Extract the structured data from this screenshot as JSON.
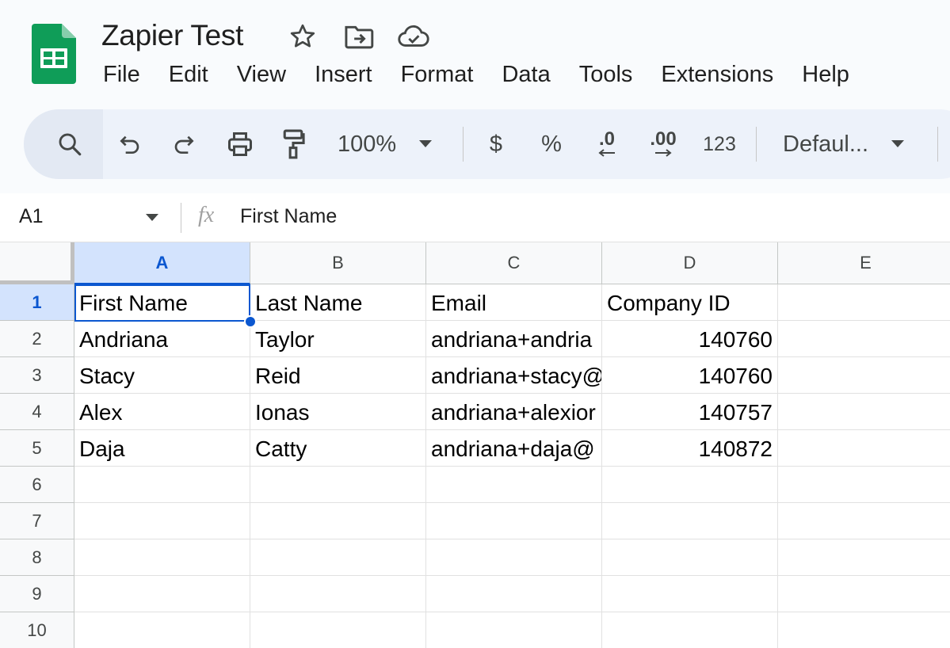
{
  "document": {
    "title": "Zapier Test",
    "star_icon": "star-icon",
    "move_icon": "move-to-folder-icon",
    "status_icon": "cloud-saved-icon",
    "logo_icon": "google-sheets-logo",
    "brand_color": "#0f9d58"
  },
  "menu": [
    "File",
    "Edit",
    "View",
    "Insert",
    "Format",
    "Data",
    "Tools",
    "Extensions",
    "Help"
  ],
  "toolbar": {
    "zoom": "100%",
    "currency_label": "$",
    "percent_label": "%",
    "decrease_decimal_label": ".0",
    "increase_decimal_label": ".00",
    "number_format_label": "123",
    "font_label": "Defaul..."
  },
  "formula_bar": {
    "cell_ref": "A1",
    "fx_label": "fx",
    "value": "First Name"
  },
  "sheet": {
    "columns": [
      "A",
      "B",
      "C",
      "D",
      "E"
    ],
    "rows": [
      "1",
      "2",
      "3",
      "4",
      "5",
      "6",
      "7",
      "8",
      "9",
      "10"
    ],
    "selected_cell": "A1",
    "selection_color": "#0b57d0",
    "cells": [
      [
        "First Name",
        "Last Name",
        "Email",
        "Company ID",
        ""
      ],
      [
        "Andriana",
        "Taylor",
        "andriana+andria",
        "140760",
        ""
      ],
      [
        "Stacy",
        "Reid",
        "andriana+stacy@",
        "140760",
        ""
      ],
      [
        "Alex",
        "Ionas",
        "andriana+alexior",
        "140757",
        ""
      ],
      [
        "Daja",
        "Catty",
        "andriana+daja@",
        "140872",
        ""
      ],
      [
        "",
        "",
        "",
        "",
        ""
      ],
      [
        "",
        "",
        "",
        "",
        ""
      ],
      [
        "",
        "",
        "",
        "",
        ""
      ],
      [
        "",
        "",
        "",
        "",
        ""
      ],
      [
        "",
        "",
        "",
        "",
        ""
      ]
    ]
  }
}
